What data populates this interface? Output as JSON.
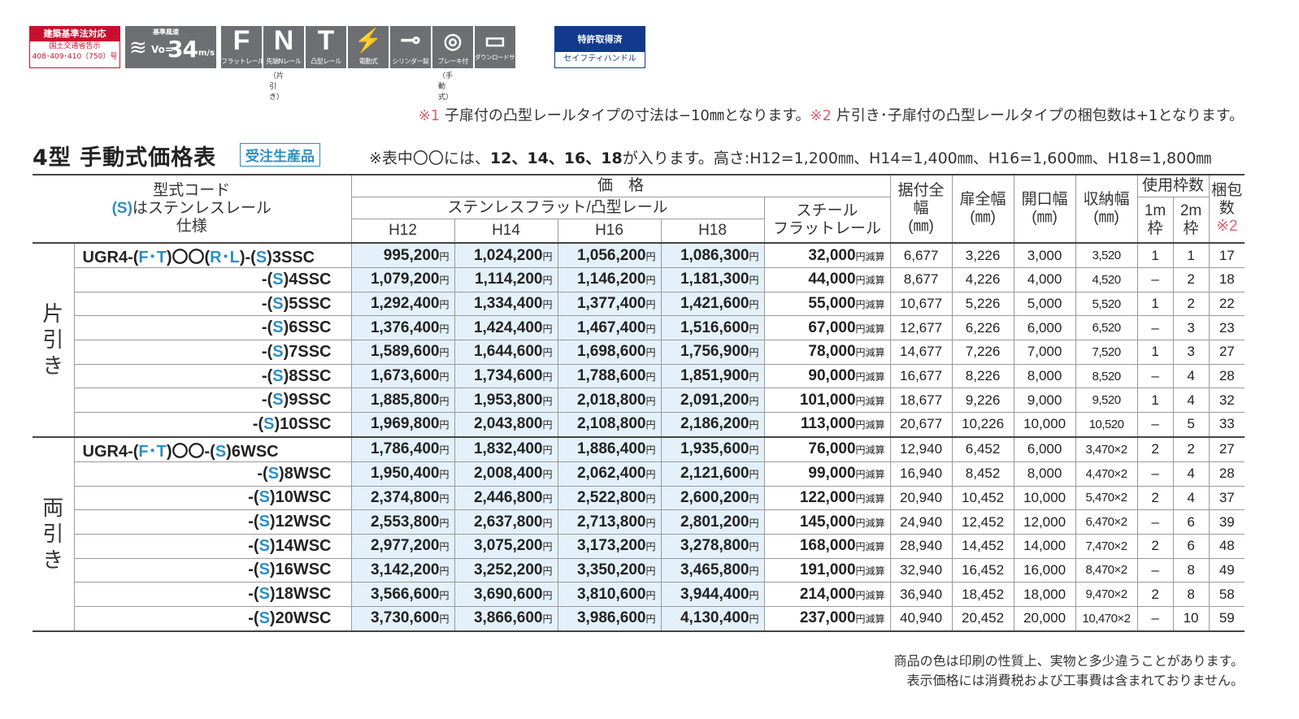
{
  "badges": {
    "building_std": {
      "title": "建築基準法対応",
      "line1": "国土交通省告示",
      "line2": "408･409･410（750）号"
    },
    "wind": {
      "top": "基準風速",
      "vo": "Vo=",
      "num": "34",
      "unit": "m/s"
    },
    "icons": [
      {
        "glyph": "F",
        "label": "フラットレール"
      },
      {
        "glyph": "N",
        "label": "先端Nレール"
      },
      {
        "glyph": "T",
        "label": "凸型レール"
      },
      {
        "glyph": "⚡",
        "label": "電動式"
      },
      {
        "glyph": "⊸",
        "label": "シリンダー錠"
      },
      {
        "glyph": "◎",
        "label": "ブレーキ付"
      },
      {
        "glyph": "▭",
        "label": "ダウンロードサービス"
      }
    ],
    "sub_n": "（片引き）",
    "sub_brake": "（手動式）",
    "patent": {
      "title": "特許取得済",
      "sub": "セイフティハンドル"
    }
  },
  "notes": {
    "n1_mark": "※1",
    "n1_text": " 子扉付の凸型レールタイプの寸法は−10㎜となります。",
    "n2_mark": "※2",
    "n2_text": " 片引き･子扉付の凸型レールタイプの梱包数は+1となります。",
    "n3_pre": "※表中〇〇には、",
    "n3_bold": "12、14、16、18",
    "n3_post": "が入ります。高さ:H12=1,200㎜、H14=1,400㎜、H16=1,600㎜、H18=1,800㎜"
  },
  "title": "4型 手動式価格表",
  "tag": "受注生産品",
  "table": {
    "h_code_1": "型式コード",
    "h_code_2a": "(S)",
    "h_code_2b": "はステンレスレール",
    "h_code_3": "仕様",
    "h_price": "価　格",
    "h_stainless": "ステンレスフラット/凸型レール",
    "h_steel": "スチール\nフラットレール",
    "h_heights": [
      "H12",
      "H14",
      "H16",
      "H18"
    ],
    "h_install": "据付全幅\n(㎜)",
    "h_door": "扉全幅\n(㎜)",
    "h_open": "開口幅\n(㎜)",
    "h_store": "収納幅\n(㎜)",
    "h_frames": "使用枠数",
    "h_1m": "1m\n枠",
    "h_2m": "2m\n枠",
    "h_pack": "梱包\n数",
    "h_pack_note": "※2",
    "yen": "円",
    "reduce": "円減算",
    "sections": [
      {
        "label": "片引き",
        "rows": [
          {
            "code": "UGR4-(F･T)〇〇(R･L)-(S)3SSC",
            "h12": "995,200",
            "h14": "1,024,200",
            "h16": "1,056,200",
            "h18": "1,086,300",
            "steel": "32,000",
            "install": "6,677",
            "door": "3,226",
            "open": "3,000",
            "store": "3,520",
            "m1": "1",
            "m2": "1",
            "pack": "17"
          },
          {
            "code": "-(S)4SSC",
            "h12": "1,079,200",
            "h14": "1,114,200",
            "h16": "1,146,200",
            "h18": "1,181,300",
            "steel": "44,000",
            "install": "8,677",
            "door": "4,226",
            "open": "4,000",
            "store": "4,520",
            "m1": "–",
            "m2": "2",
            "pack": "18"
          },
          {
            "code": "-(S)5SSC",
            "h12": "1,292,400",
            "h14": "1,334,400",
            "h16": "1,377,400",
            "h18": "1,421,600",
            "steel": "55,000",
            "install": "10,677",
            "door": "5,226",
            "open": "5,000",
            "store": "5,520",
            "m1": "1",
            "m2": "2",
            "pack": "22"
          },
          {
            "code": "-(S)6SSC",
            "h12": "1,376,400",
            "h14": "1,424,400",
            "h16": "1,467,400",
            "h18": "1,516,600",
            "steel": "67,000",
            "install": "12,677",
            "door": "6,226",
            "open": "6,000",
            "store": "6,520",
            "m1": "–",
            "m2": "3",
            "pack": "23"
          },
          {
            "code": "-(S)7SSC",
            "h12": "1,589,600",
            "h14": "1,644,600",
            "h16": "1,698,600",
            "h18": "1,756,900",
            "steel": "78,000",
            "install": "14,677",
            "door": "7,226",
            "open": "7,000",
            "store": "7,520",
            "m1": "1",
            "m2": "3",
            "pack": "27"
          },
          {
            "code": "-(S)8SSC",
            "h12": "1,673,600",
            "h14": "1,734,600",
            "h16": "1,788,600",
            "h18": "1,851,900",
            "steel": "90,000",
            "install": "16,677",
            "door": "8,226",
            "open": "8,000",
            "store": "8,520",
            "m1": "–",
            "m2": "4",
            "pack": "28"
          },
          {
            "code": "-(S)9SSC",
            "h12": "1,885,800",
            "h14": "1,953,800",
            "h16": "2,018,800",
            "h18": "2,091,200",
            "steel": "101,000",
            "install": "18,677",
            "door": "9,226",
            "open": "9,000",
            "store": "9,520",
            "m1": "1",
            "m2": "4",
            "pack": "32"
          },
          {
            "code": "-(S)10SSC",
            "h12": "1,969,800",
            "h14": "2,043,800",
            "h16": "2,108,800",
            "h18": "2,186,200",
            "steel": "113,000",
            "install": "20,677",
            "door": "10,226",
            "open": "10,000",
            "store": "10,520",
            "m1": "–",
            "m2": "5",
            "pack": "33"
          }
        ]
      },
      {
        "label": "両引き",
        "rows": [
          {
            "code": "UGR4-(F･T)〇〇-(S)6WSC",
            "h12": "1,786,400",
            "h14": "1,832,400",
            "h16": "1,886,400",
            "h18": "1,935,600",
            "steel": "76,000",
            "install": "12,940",
            "door": "6,452",
            "open": "6,000",
            "store": "3,470×2",
            "m1": "2",
            "m2": "2",
            "pack": "27"
          },
          {
            "code": "-(S)8WSC",
            "h12": "1,950,400",
            "h14": "2,008,400",
            "h16": "2,062,400",
            "h18": "2,121,600",
            "steel": "99,000",
            "install": "16,940",
            "door": "8,452",
            "open": "8,000",
            "store": "4,470×2",
            "m1": "–",
            "m2": "4",
            "pack": "28"
          },
          {
            "code": "-(S)10WSC",
            "h12": "2,374,800",
            "h14": "2,446,800",
            "h16": "2,522,800",
            "h18": "2,600,200",
            "steel": "122,000",
            "install": "20,940",
            "door": "10,452",
            "open": "10,000",
            "store": "5,470×2",
            "m1": "2",
            "m2": "4",
            "pack": "37"
          },
          {
            "code": "-(S)12WSC",
            "h12": "2,553,800",
            "h14": "2,637,800",
            "h16": "2,713,800",
            "h18": "2,801,200",
            "steel": "145,000",
            "install": "24,940",
            "door": "12,452",
            "open": "12,000",
            "store": "6,470×2",
            "m1": "–",
            "m2": "6",
            "pack": "39"
          },
          {
            "code": "-(S)14WSC",
            "h12": "2,977,200",
            "h14": "3,075,200",
            "h16": "3,173,200",
            "h18": "3,278,800",
            "steel": "168,000",
            "install": "28,940",
            "door": "14,452",
            "open": "14,000",
            "store": "7,470×2",
            "m1": "2",
            "m2": "6",
            "pack": "48"
          },
          {
            "code": "-(S)16WSC",
            "h12": "3,142,200",
            "h14": "3,252,200",
            "h16": "3,350,200",
            "h18": "3,465,800",
            "steel": "191,000",
            "install": "32,940",
            "door": "16,452",
            "open": "16,000",
            "store": "8,470×2",
            "m1": "–",
            "m2": "8",
            "pack": "49"
          },
          {
            "code": "-(S)18WSC",
            "h12": "3,566,600",
            "h14": "3,690,600",
            "h16": "3,810,600",
            "h18": "3,944,400",
            "steel": "214,000",
            "install": "36,940",
            "door": "18,452",
            "open": "18,000",
            "store": "9,470×2",
            "m1": "2",
            "m2": "8",
            "pack": "58"
          },
          {
            "code": "-(S)20WSC",
            "h12": "3,730,600",
            "h14": "3,866,600",
            "h16": "3,986,600",
            "h18": "4,130,400",
            "steel": "237,000",
            "install": "40,940",
            "door": "20,452",
            "open": "20,000",
            "store": "10,470×2",
            "m1": "–",
            "m2": "10",
            "pack": "59"
          }
        ]
      }
    ]
  },
  "footer": {
    "line1": "商品の色は印刷の性質上、実物と多少違うことがあります。",
    "line2": "表示価格には消費税および工事費は含まれておりません。"
  },
  "colors": {
    "accent_blue": "#2d8ec4",
    "price_bg": "#e4f1fb",
    "note_red": "#e06070",
    "badge_red": "#c8102e",
    "badge_navy": "#123a8c"
  }
}
